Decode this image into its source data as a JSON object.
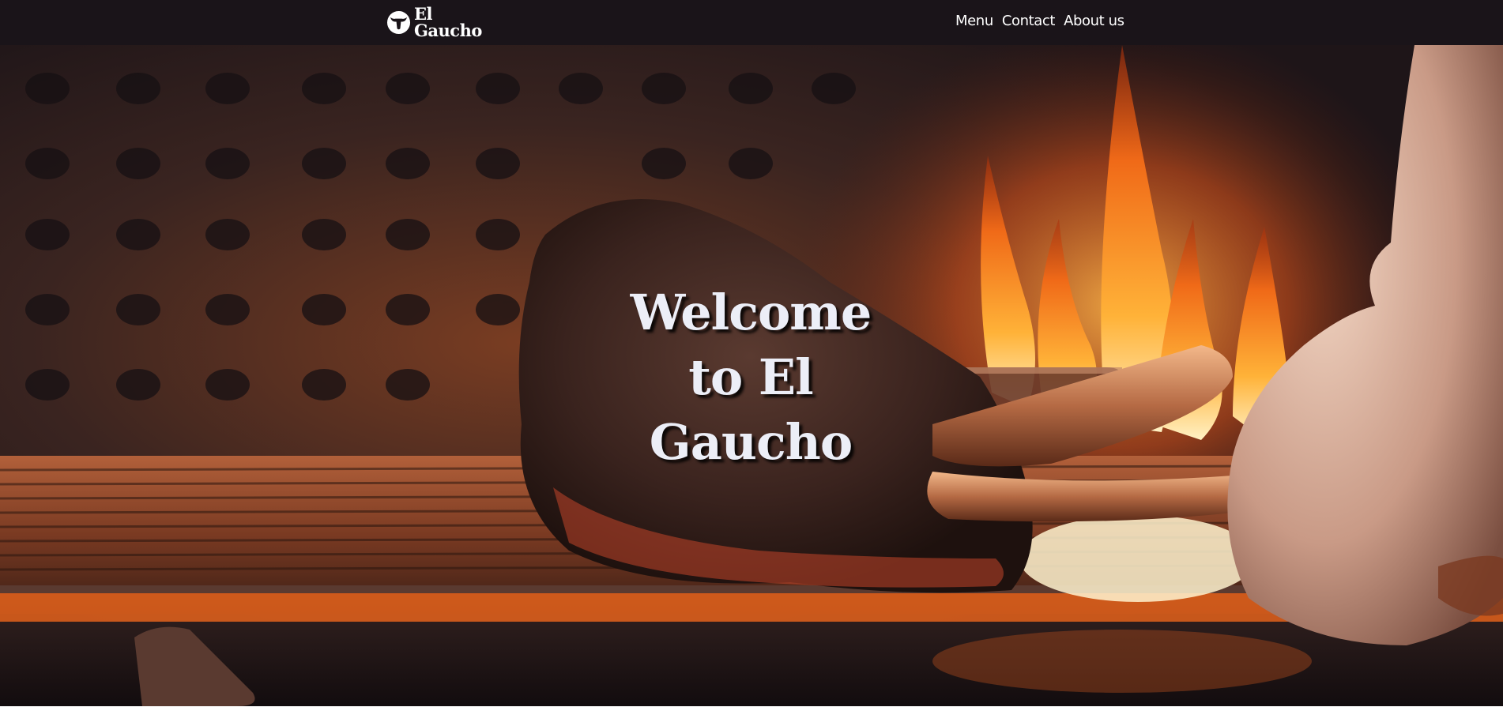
{
  "brand": {
    "name_line1": "El",
    "name_line2": "Gaucho",
    "icon": "steer-head-icon"
  },
  "nav": {
    "items": [
      {
        "label": "Menu"
      },
      {
        "label": "Contact"
      },
      {
        "label": "About us"
      }
    ]
  },
  "hero": {
    "title_line1": "Welcome",
    "title_line2": "to El",
    "title_line3": "Gaucho",
    "background": "grilled-steak-over-flames-photo"
  },
  "colors": {
    "navbar": "#1a1419",
    "title": "#eceef7",
    "flame": "#ff7a1a"
  }
}
